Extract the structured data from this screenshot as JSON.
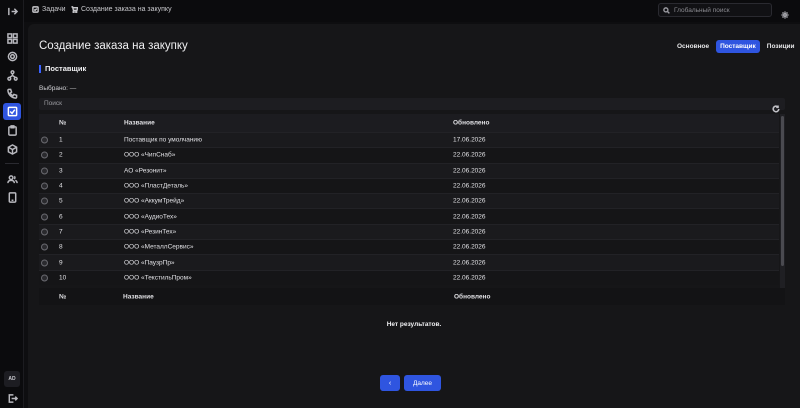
{
  "breadcrumb": {
    "parent": "Задачи",
    "current": "Создание заказа на закупку"
  },
  "global_search": {
    "placeholder": "Глобальный поиск"
  },
  "sidebar": {
    "icons": [
      "collapse-icon",
      "dashboard-icon",
      "settings-icon",
      "network-icon",
      "phone-icon",
      "tasks-icon",
      "clipboard-icon",
      "box-icon",
      "users-icon",
      "device-icon"
    ],
    "avatar_initials": "AD",
    "logout_icon": "logout-icon"
  },
  "page": {
    "title": "Создание заказа на закупку",
    "tabs": [
      {
        "label": "Основное",
        "active": false
      },
      {
        "label": "Поставщик",
        "active": true
      },
      {
        "label": "Позиции",
        "active": false
      }
    ],
    "section_title": "Поставщик",
    "selected_label": "Выбрано: —",
    "filter_placeholder": "Поиск"
  },
  "table": {
    "columns": [
      "№",
      "Название",
      "Обновлено"
    ],
    "rows": [
      {
        "num": "1",
        "name": "Поставщик по умолчанию",
        "updated": "17.06.2026"
      },
      {
        "num": "2",
        "name": "ООО «ЧипСнаб»",
        "updated": "22.06.2026"
      },
      {
        "num": "3",
        "name": "АО «Резонит»",
        "updated": "22.06.2026"
      },
      {
        "num": "4",
        "name": "ООО «ПластДеталь»",
        "updated": "22.06.2026"
      },
      {
        "num": "5",
        "name": "ООО «АккумТрейд»",
        "updated": "22.06.2026"
      },
      {
        "num": "6",
        "name": "ООО «АудиоТех»",
        "updated": "22.06.2026"
      },
      {
        "num": "7",
        "name": "ООО «РезинТех»",
        "updated": "22.06.2026"
      },
      {
        "num": "8",
        "name": "ООО «МеталлСервис»",
        "updated": "22.06.2026"
      },
      {
        "num": "9",
        "name": "ООО «ПаузрПр»",
        "updated": "22.06.2026"
      },
      {
        "num": "10",
        "name": "ООО «ТекстильПром»",
        "updated": "22.06.2026"
      }
    ]
  },
  "second_table": {
    "columns": [
      "№",
      "Название",
      "Обновлено"
    ],
    "empty_message": "Нет результатов."
  },
  "navigation": {
    "prev_label": "‹",
    "next_label": "Далее"
  },
  "colors": {
    "accent": "#2f55e0",
    "background": "#0e0e10",
    "panel": "#161618"
  }
}
